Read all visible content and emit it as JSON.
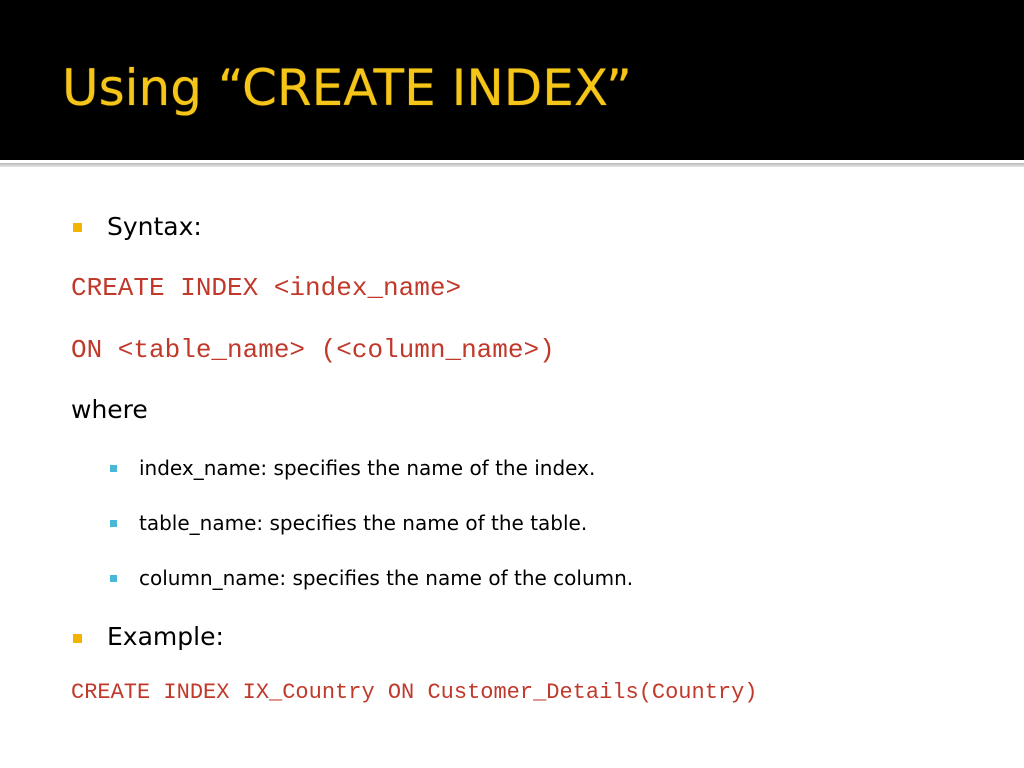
{
  "slide": {
    "title": "Using “CREATE INDEX”",
    "syntax_label": "Syntax:",
    "syntax_code_line1": "CREATE INDEX <index_name>",
    "syntax_code_line2": "ON <table_name> (<column_name>)",
    "where_label": "where",
    "definitions": [
      "index_name: specifies the name of the index.",
      "table_name: specifies the name of the table.",
      "column_name: specifies the name of the column."
    ],
    "example_label": "Example:",
    "example_code": "CREATE INDEX IX_Country ON Customer_Details(Country)"
  },
  "colors": {
    "title": "#f5c518",
    "title_bar": "#000000",
    "code": "#c0392b",
    "bullet_main": "#f2b400",
    "bullet_sub": "#49b7d8"
  },
  "icons": {
    "main_bullet": "square-bullet-icon",
    "sub_bullet": "small-square-bullet-icon"
  }
}
